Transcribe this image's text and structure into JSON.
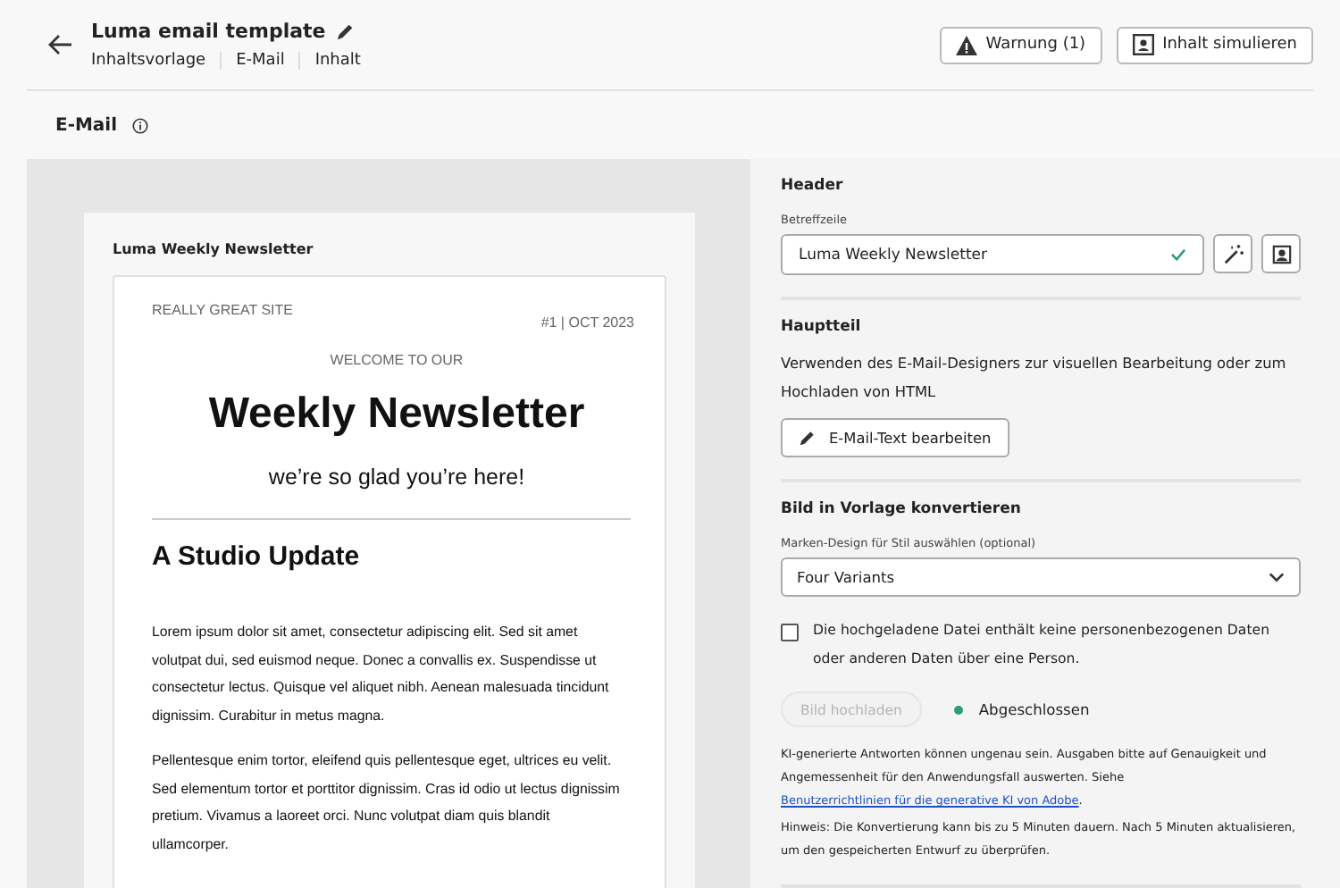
{
  "header": {
    "title": "Luma email template",
    "breadcrumbs": [
      "Inhaltsvorlage",
      "E-Mail",
      "Inhalt"
    ],
    "buttons": [
      {
        "kind": "warning",
        "label": "Warnung (1)"
      },
      {
        "kind": "simulate",
        "label": "Inhalt simulieren"
      }
    ]
  },
  "section_title": "E-Mail",
  "preview": {
    "subject": "Luma Weekly Newsletter",
    "site": "REALLY GREAT SITE",
    "issue": "#1  |  OCT 2023",
    "welcome": "WELCOME TO OUR",
    "headline": "Weekly Newsletter",
    "tagline": "we’re so glad you’re here!",
    "section_heading": "A Studio Update",
    "paragraphs": [
      "Lorem ipsum dolor sit amet, consectetur adipiscing elit. Sed sit amet volutpat dui, sed euismod neque. Donec a convallis ex. Suspendisse ut consectetur lectus. Quisque vel aliquet nibh. Aenean malesuada tincidunt dignissim. Curabitur in metus magna.",
      "Pellentesque enim tortor, eleifend quis pellentesque eget, ultrices eu velit. Sed elementum tortor et porttitor dignissim. Cras id odio ut lectus dignissim pretium. Vivamus a laoreet orci. Nunc volutpat diam quis blandit ullamcorper."
    ]
  },
  "panel": {
    "header": {
      "title": "Header",
      "subject_label": "Betreffzeile",
      "subject_value": "Luma Weekly Newsletter",
      "valid": true
    },
    "body": {
      "title": "Hauptteil",
      "description": "Verwenden des E-Mail-Designers zur visuellen Bearbeitung oder zum Hochladen von HTML",
      "button": "E-Mail-Text bearbeiten"
    },
    "convert": {
      "title": "Bild in Vorlage konvertieren",
      "select_label": "Marken-Design für Stil auswählen (optional)",
      "select_value": "Four Variants",
      "checkbox_label": "Die hochgeladene Datei enthält keine personenbezogenen Daten oder anderen Daten über eine Person.",
      "checked": false,
      "upload_button": "Bild hochladen",
      "upload_disabled": true,
      "status": {
        "label": "Abgeschlossen",
        "color": "#2d9d78"
      },
      "disclaimer": "KI-generierte Antworten können ungenau sein. Ausgaben bitte auf Genauigkeit und Angemessenheit für den Anwendungsfall auswerten. Siehe",
      "disclaimer_link": "Benutzerrichtlinien für die generative KI von Adobe",
      "disclaimer_end": ".",
      "note": "Hinweis: Die Konvertierung kann bis zu 5 Minuten dauern. Nach 5 Minuten aktualisieren, um den gespeicherten Entwurf zu überprüfen."
    }
  }
}
